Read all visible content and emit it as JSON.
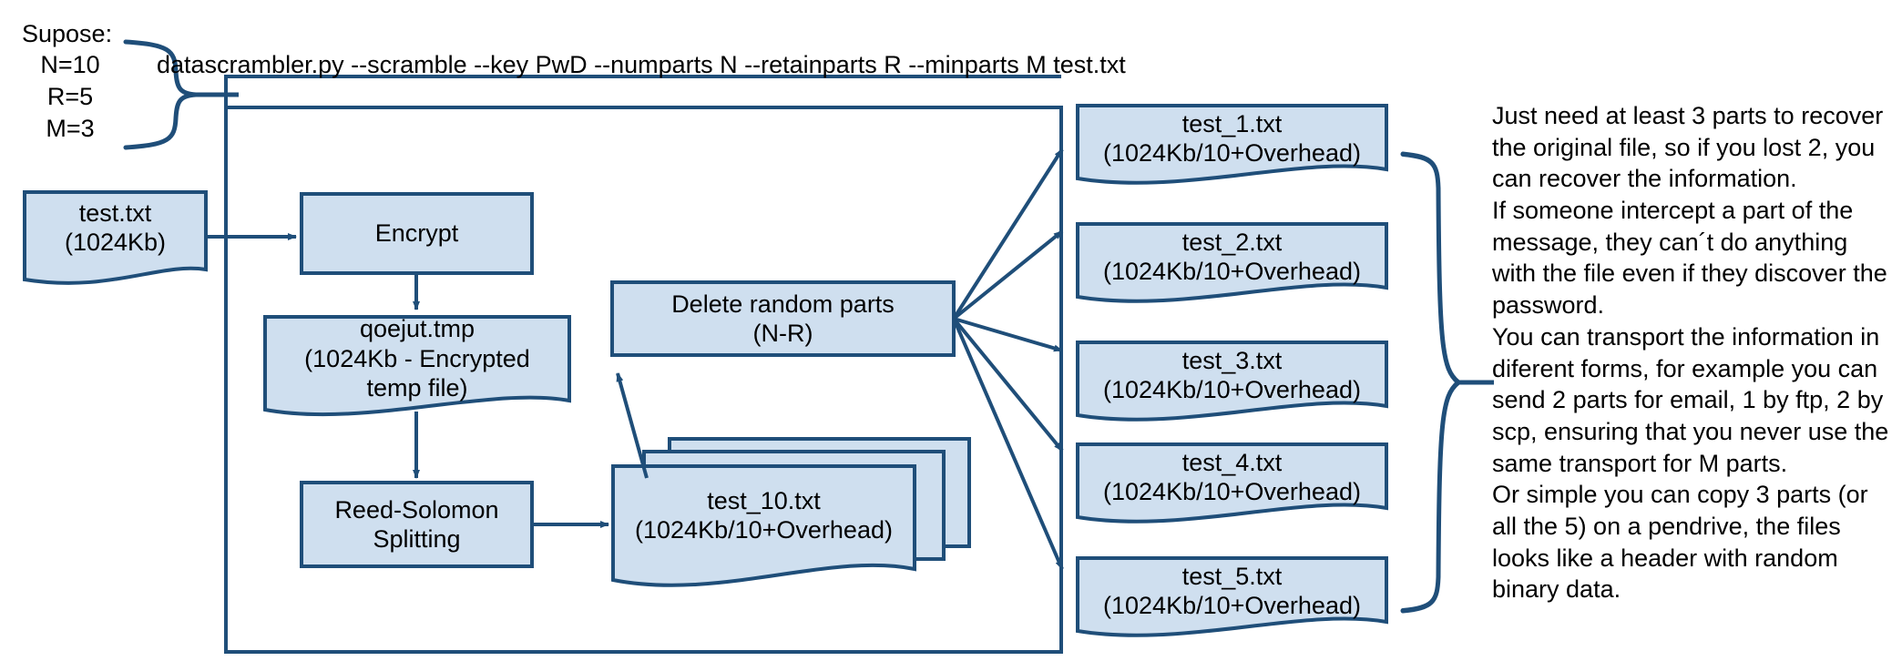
{
  "diagram": {
    "title": "datascrambler.py scramble workflow",
    "colors": {
      "box_fill": "#cfdfef",
      "box_stroke": "#1f4e79",
      "arrow": "#1f4e79",
      "text": "#000000",
      "background": "#ffffff"
    }
  },
  "assumptions": {
    "heading": "Supose:",
    "lines": "N=10\nR=5\nM=3",
    "values": [
      {
        "name": "N",
        "value": "10"
      },
      {
        "name": "R",
        "value": "5"
      },
      {
        "name": "M",
        "value": "3"
      }
    ]
  },
  "command": {
    "text": "datascrambler.py --scramble --key PwD --numparts N --retainparts R --minparts M test.txt",
    "program": "datascrambler.py",
    "options": [
      "--scramble",
      "--key PwD",
      "--numparts N",
      "--retainparts R",
      "--minparts M"
    ],
    "input_file": "test.txt"
  },
  "nodes": {
    "input_file": {
      "line1": "test.txt",
      "line2": "(1024Kb)"
    },
    "encrypt": {
      "line1": "Encrypt"
    },
    "temp_file": {
      "line1": "qoejut.tmp",
      "line2": "(1024Kb - Encrypted",
      "line3": "temp file)"
    },
    "reed_solomon": {
      "line1": "Reed-Solomon",
      "line2": "Splitting"
    },
    "parts_stack": {
      "line1": "test_10.txt",
      "line2": "(1024Kb/10+Overhead)"
    },
    "delete_random": {
      "line1": "Delete random parts",
      "line2": "(N-R)"
    }
  },
  "outputs": [
    {
      "line1": "test_1.txt",
      "line2": "(1024Kb/10+Overhead)"
    },
    {
      "line1": "test_2.txt",
      "line2": "(1024Kb/10+Overhead)"
    },
    {
      "line1": "test_3.txt",
      "line2": "(1024Kb/10+Overhead)"
    },
    {
      "line1": "test_4.txt",
      "line2": "(1024Kb/10+Overhead)"
    },
    {
      "line1": "test_5.txt",
      "line2": "(1024Kb/10+Overhead)"
    }
  ],
  "notes": {
    "body": "Just need at least 3 parts to recover\nthe original file, so if you lost 2, you\ncan recover the information.\nIf someone intercept a part of the\nmessage, they can´t do anything\nwith the file even if they discover the\npassword.\nYou can transport the information in\ndiferent forms, for example you can\nsend 2 parts for email, 1 by ftp, 2 by\nscp, ensuring that you never use the\nsame transport for M parts.\nOr simple you can copy 3 parts (or\nall the 5) on a pendrive, the files\nlooks like a header with random\nbinary data.",
    "paragraphs": [
      "Just need at least 3 parts to recover the original file, so if you lost 2, you can recover the information.",
      "If someone intercept a part of the message, they can´t do anything with the file even if they discover the password.",
      "You can transport the information in diferent forms, for example you can send 2 parts for email, 1 by ftp, 2 by scp, ensuring that you never use the same transport for M parts.",
      "Or simple you can copy 3 parts (or all the 5) on a pendrive, the files looks like a header with random binary data."
    ]
  }
}
